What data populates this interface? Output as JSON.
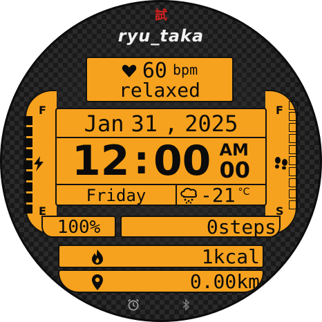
{
  "watch": {
    "user_name": "ryu_taka",
    "logo_glyph": "試",
    "heart": {
      "icon": "heart-icon",
      "value": "60",
      "unit": "bpm",
      "status": "relaxed"
    },
    "date": {
      "month": "Jan",
      "day": "31",
      "separator": ",",
      "year": "2025"
    },
    "time": {
      "hours": "12",
      "colon": ":",
      "minutes": "00",
      "ampm": "AM",
      "seconds": "00"
    },
    "weekday": "Friday",
    "weather": {
      "icon": "cloud-snow-icon",
      "temperature": "-21",
      "unit": "°C"
    },
    "battery": {
      "percent": "100%",
      "level": 1.0,
      "full_label": "F",
      "empty_label": "E",
      "icon": "lightning-icon"
    },
    "steps_gauge": {
      "full_label": "F",
      "start_label": "S",
      "level": 0.0,
      "icon": "footprints-icon"
    },
    "steps": "0steps",
    "calories": {
      "icon": "flame-icon",
      "value": "1kcal"
    },
    "distance": {
      "icon": "location-pin-icon",
      "value": "0.00km"
    },
    "bottom_icons": {
      "alarm": "alarm-icon",
      "bluetooth": "bluetooth-icon"
    },
    "colors": {
      "accent": "#f7a21e",
      "ink": "#0b0b0b",
      "logo": "#d62020"
    }
  }
}
